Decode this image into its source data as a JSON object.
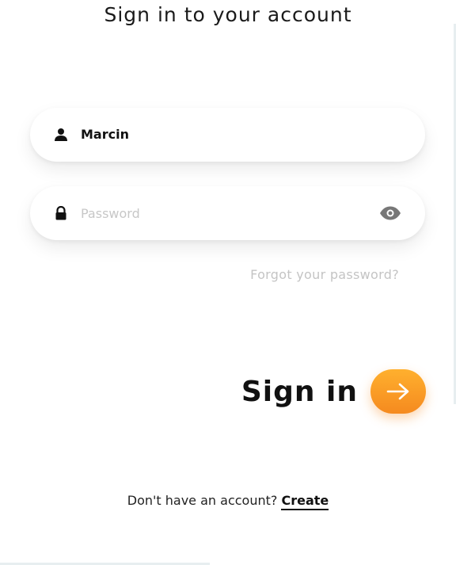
{
  "header": {
    "title": "Sign in to your account"
  },
  "form": {
    "username": {
      "value": "Marcin",
      "icon": "person-icon"
    },
    "password": {
      "value": "",
      "placeholder": "Password",
      "icon": "lock-icon",
      "toggle_icon": "eye-icon"
    },
    "forgot_label": "Forgot your password?"
  },
  "submit": {
    "label": "Sign in",
    "icon": "arrow-right-icon",
    "accent_color": "#f7941d"
  },
  "footer": {
    "prompt": "Don't have an account?",
    "link_label": "Create"
  }
}
